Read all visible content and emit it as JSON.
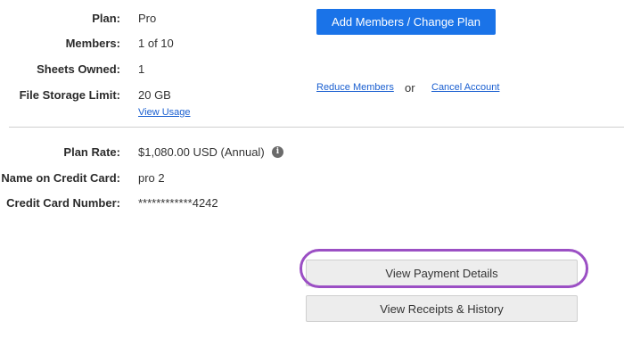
{
  "plan": {
    "plan_label": "Plan:",
    "plan_value": "Pro",
    "members_label": "Members:",
    "members_value": "1 of 10",
    "sheets_label": "Sheets Owned:",
    "sheets_value": "1",
    "storage_label": "File Storage Limit:",
    "storage_value": "20 GB",
    "view_usage_link": "View Usage"
  },
  "actions": {
    "add_members_button": "Add Members / Change Plan",
    "reduce_members_link": "Reduce Members",
    "or_text": "or",
    "cancel_account_link": "Cancel Account"
  },
  "billing": {
    "rate_label": "Plan Rate:",
    "rate_value": "$1,080.00 USD (Annual)",
    "info_icon": "info-icon",
    "name_label": "Name on Credit Card:",
    "name_value": "pro 2",
    "card_label": "Credit Card Number:",
    "card_value": "************4242"
  },
  "buttons": {
    "view_payment_details": "View Payment Details",
    "view_receipts_history": "View Receipts & History"
  },
  "colors": {
    "primary_button": "#1a73e8",
    "link": "#1a5fd0",
    "highlight": "#9b4fc4",
    "secondary_button": "#ededed"
  }
}
